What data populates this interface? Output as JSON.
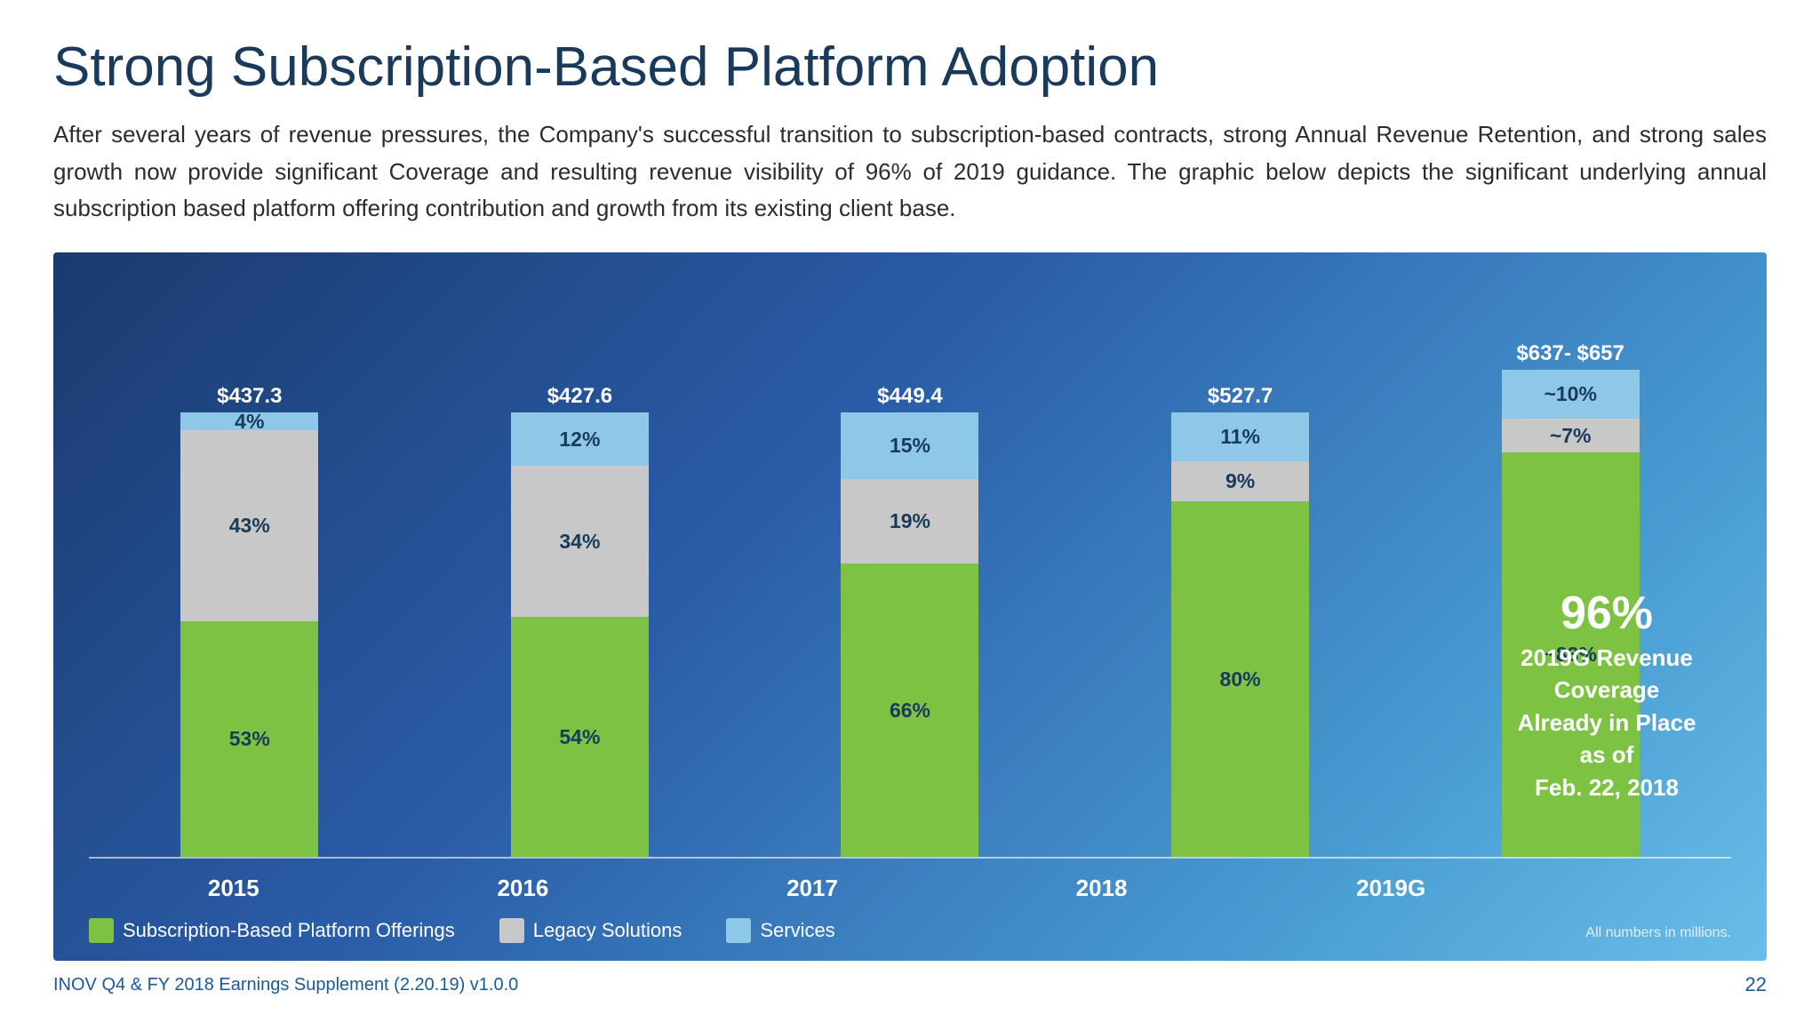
{
  "title": "Strong Subscription-Based Platform Adoption",
  "subtitle": "After several years of revenue pressures, the Company's successful transition to subscription-based contracts, strong Annual Revenue Retention, and strong sales growth now provide significant Coverage and resulting revenue visibility of 96% of 2019 guidance. The graphic below depicts the significant underlying annual subscription based platform offering contribution and growth from its existing client base.",
  "chart": {
    "bars": [
      {
        "year": "2015",
        "total": "$437.3",
        "subscription_pct": "53%",
        "subscription_h": 265,
        "legacy_pct": "43%",
        "legacy_h": 215,
        "services_pct": "4%",
        "services_h": 20
      },
      {
        "year": "2016",
        "total": "$427.6",
        "subscription_pct": "54%",
        "subscription_h": 270,
        "legacy_pct": "34%",
        "legacy_h": 170,
        "services_pct": "12%",
        "services_h": 60
      },
      {
        "year": "2017",
        "total": "$449.4",
        "subscription_pct": "66%",
        "subscription_h": 330,
        "legacy_pct": "19%",
        "legacy_h": 95,
        "services_pct": "15%",
        "services_h": 75
      },
      {
        "year": "2018",
        "total": "$527.7",
        "subscription_pct": "80%",
        "subscription_h": 400,
        "legacy_pct": "9%",
        "legacy_h": 45,
        "services_pct": "11%",
        "services_h": 55
      },
      {
        "year": "2019G",
        "total": "$637- $657",
        "subscription_pct": "~83%",
        "subscription_h": 455,
        "legacy_pct": "~7%",
        "legacy_h": 38,
        "services_pct": "~10%",
        "services_h": 55
      }
    ],
    "legend": [
      {
        "label": "Subscription-Based Platform Offerings",
        "color": "#7dc242"
      },
      {
        "label": "Legacy Solutions",
        "color": "#c8c8c8"
      },
      {
        "label": "Services",
        "color": "#8ec8e8"
      }
    ],
    "annotation": {
      "pct": "96%",
      "line1": "2019G Revenue",
      "line2": "Coverage",
      "line3": "Already in Place",
      "line4": "as of",
      "line5": "Feb. 22, 2018"
    },
    "all_numbers_note": "All numbers in millions."
  },
  "footer": {
    "left": "INOV Q4 & FY 2018 Earnings Supplement (2.20.19) v1.0.0",
    "right": "22"
  }
}
